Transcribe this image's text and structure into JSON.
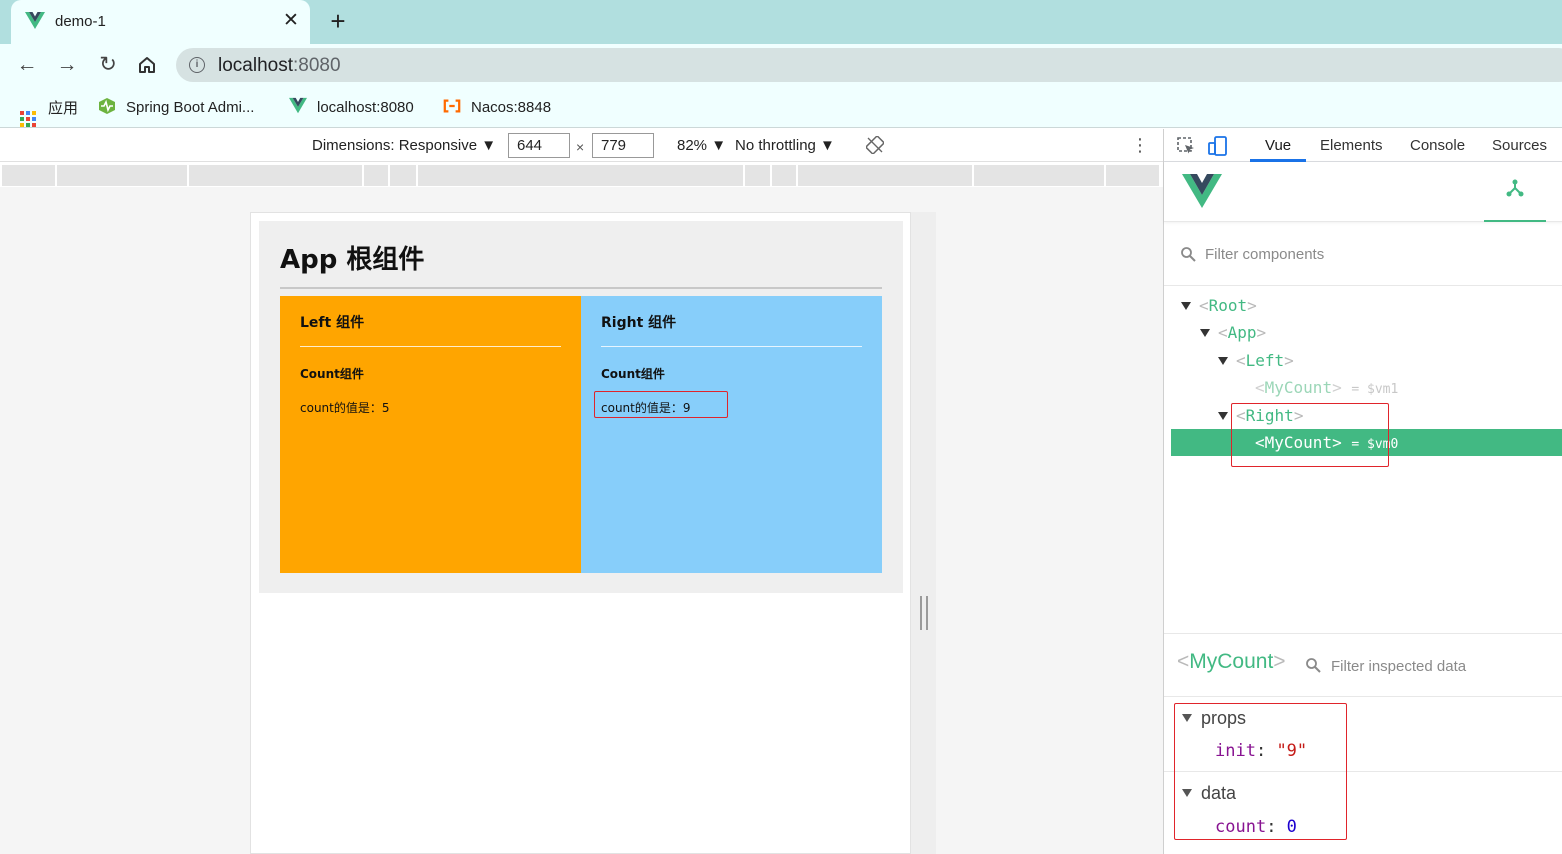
{
  "browser": {
    "tab": {
      "title": "demo-1",
      "close": "✕"
    },
    "new_tab": "+",
    "url": {
      "host": "localhost",
      "port": ":8080"
    },
    "bookmarks": [
      {
        "label": "应用",
        "icon": "apps-grid-icon"
      },
      {
        "label": "Spring Boot Admi...",
        "icon": "spring-boot-admin-icon"
      },
      {
        "label": "localhost:8080",
        "icon": "vue-icon"
      },
      {
        "label": "Nacos:8848",
        "icon": "nacos-icon"
      }
    ]
  },
  "device_toolbar": {
    "dimensions": "Dimensions: Responsive ▼",
    "width": "644",
    "height": "779",
    "x": "×",
    "zoom": "82% ▼",
    "throttling": "No throttling ▼",
    "more": "⋮"
  },
  "app": {
    "title": "App 根组件",
    "left": {
      "title": "Left 组件",
      "count_title": "Count组件",
      "count_value": "count的值是：5"
    },
    "right": {
      "title": "Right 组件",
      "count_title": "Count组件",
      "count_value": "count的值是：9"
    }
  },
  "devtools": {
    "tabs": [
      "Vue",
      "Elements",
      "Console",
      "Sources"
    ],
    "active_tab": "Vue",
    "filter_components_placeholder": "Filter components",
    "tree": [
      {
        "name": "Root",
        "depth": 0,
        "expanded": true
      },
      {
        "name": "App",
        "depth": 1,
        "expanded": true
      },
      {
        "name": "Left",
        "depth": 2,
        "expanded": true
      },
      {
        "name": "MyCount",
        "depth": 3,
        "ref": "= $vm1"
      },
      {
        "name": "Right",
        "depth": 2,
        "expanded": true
      },
      {
        "name": "MyCount",
        "depth": 3,
        "ref": "= $vm0",
        "selected": true
      }
    ],
    "inspector": {
      "component": "MyCount",
      "filter_placeholder": "Filter inspected data",
      "props_label": "props",
      "props": {
        "key": "init",
        "value": "\"9\""
      },
      "data_label": "data",
      "data": {
        "key": "count",
        "value": "0"
      }
    }
  },
  "colors": {
    "vue_green": "#42b983",
    "left_bg": "#ffa500",
    "right_bg": "#87cefa",
    "highlight_red": "#e0242b",
    "tab_strip": "#b1dfdf"
  }
}
